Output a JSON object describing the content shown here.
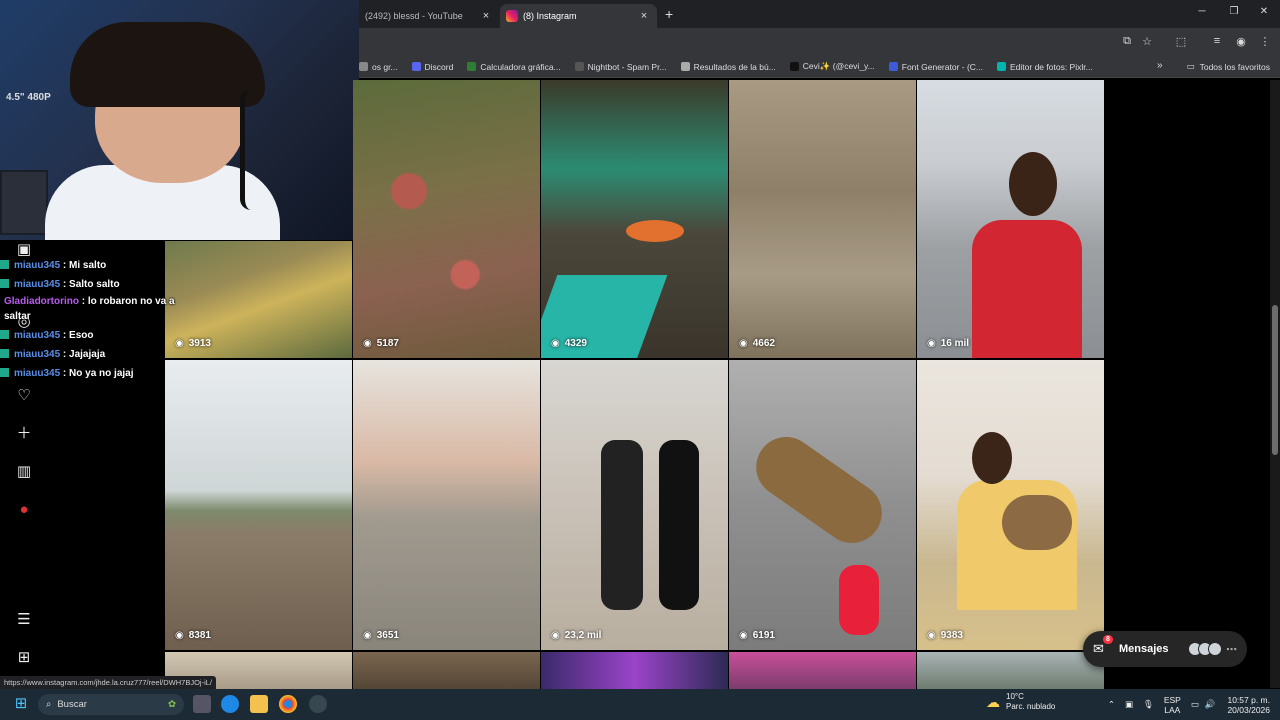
{
  "browser": {
    "tabs": [
      {
        "label": "(2492) blessd - YouTube",
        "active": false
      },
      {
        "label": "(8) Instagram",
        "active": true
      }
    ],
    "new_tab": "+",
    "bookmarks": [
      {
        "label": "os gr...",
        "color": "#888888"
      },
      {
        "label": "Discord",
        "color": "#5865f2"
      },
      {
        "label": "Calculadora gráfica...",
        "color": "#2e7d32"
      },
      {
        "label": "Nightbot - Spam Pr...",
        "color": "#555555"
      },
      {
        "label": "Resultados de la bú...",
        "color": "#aaaaaa"
      },
      {
        "label": "Cevi✨ (@cevi_y...",
        "color": "#111111"
      },
      {
        "label": "Font Generator - (C...",
        "color": "#3b5bdb"
      },
      {
        "label": "Editor de fotos: Pixlr...",
        "color": "#00b5ad"
      }
    ],
    "bookmarks_more": "»",
    "all_favorites": "Todos los favoritos"
  },
  "chat": {
    "messages": [
      {
        "user": "miauu345",
        "text": ": Mi salto"
      },
      {
        "user": "miauu345",
        "text": ": Salto salto"
      },
      {
        "user": "Gladiadortorino",
        "text": ": lo robaron no va a saltar"
      },
      {
        "user": "miauu345",
        "text": ": Esoo"
      },
      {
        "user": "miauu345",
        "text": ": Jajajaja"
      },
      {
        "user": "miauu345",
        "text": ": No ya no jajaj"
      }
    ]
  },
  "webcam": {
    "label": "4.5\" 480P"
  },
  "grid": {
    "views": [
      "3913",
      "5187",
      "4329",
      "4662",
      "16 mil",
      "8381",
      "3651",
      "23,2 mil",
      "6191",
      "9383"
    ]
  },
  "messages_pill": {
    "label": "Mensajes",
    "badge": "8"
  },
  "status_url": "https://www.instagram.com/jhde.la.cruz777/reel/DWH7BJOj-iL/",
  "taskbar": {
    "search_placeholder": "Buscar",
    "weather_temp": "10°C",
    "weather_desc": "Parc. nublado",
    "lang_1": "ESP",
    "lang_2": "LAA",
    "time": "10:57 p. m.",
    "date": "20/03/2026"
  }
}
